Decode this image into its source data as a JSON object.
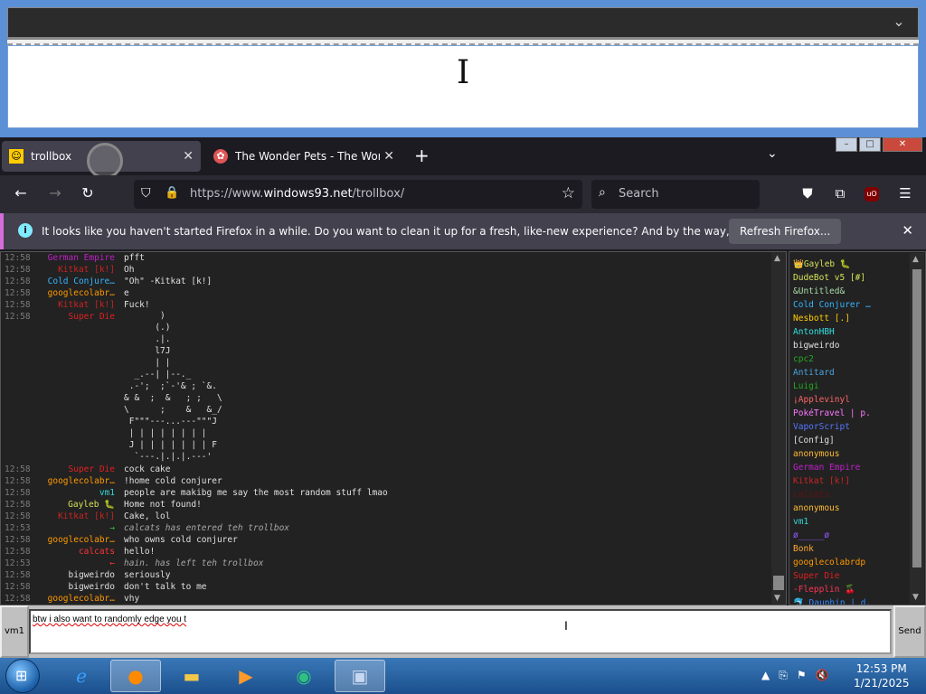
{
  "tabs": [
    {
      "title": "trollbox",
      "favicon": "trollbox-icon"
    },
    {
      "title": "The Wonder Pets - The Wonder",
      "favicon": "wonderpets-icon"
    }
  ],
  "navbar": {
    "url_prefix": "https://www.",
    "url_domain": "windows93.net",
    "url_path": "/trollbox/",
    "search_placeholder": "Search"
  },
  "notification": {
    "message": "It looks like you haven't started Firefox in a while. Do you want to clean it up for a fresh, like-new experience? And by the way, welcome back!",
    "button": "Refresh Firefox..."
  },
  "chat": {
    "lines": [
      {
        "ts": "12:58",
        "nick": "German Empire",
        "color": "#c01fc9",
        "text": "pfft",
        "sys": false
      },
      {
        "ts": "12:58",
        "nick": "Kitkat [k!]",
        "color": "#cc2222",
        "text": "Oh",
        "sys": false
      },
      {
        "ts": "12:58",
        "nick": "Cold Conjure…",
        "color": "#33b5ff",
        "text": "\"Oh\" -Kitkat [k!]",
        "sys": false
      },
      {
        "ts": "12:58",
        "nick": "googlecolabr…",
        "color": "#ff9900",
        "text": "e",
        "sys": false
      },
      {
        "ts": "12:58",
        "nick": "Kitkat [k!]",
        "color": "#cc2222",
        "text": "Fuck!",
        "sys": false
      },
      {
        "ts": "12:58",
        "nick": "Super Die",
        "color": "#e02020",
        "text": "",
        "sys": false
      }
    ],
    "ascii_art": "       )\n      (.)\n      .|.\n      l7J\n      | |\n  _.--| |--._\n .-';  ;`-'& ; `&.\n& &  ;  &   ; ;   \\\n\\      ;    &   &_/\n F\"\"\"---...---\"\"\"J\n | | | | | | | |\n J | | | | | | | F\n  `---.|.|.|.---'",
    "lines2": [
      {
        "ts": "12:58",
        "nick": "Super Die",
        "color": "#e02020",
        "text": "cock cake",
        "sys": false
      },
      {
        "ts": "12:58",
        "nick": "googlecolabr…",
        "color": "#ff9900",
        "text": "!home cold conjurer",
        "sys": false
      },
      {
        "ts": "12:58",
        "nick": "vm1",
        "color": "#33d6d6",
        "text": "people are makibg me say the most random stuff lmao",
        "sys": false
      },
      {
        "ts": "12:58",
        "nick": "Gayleb 🐛",
        "color": "#d4e157",
        "text": "Home not found!",
        "sys": false
      },
      {
        "ts": "12:58",
        "nick": "Kitkat [k!]",
        "color": "#cc2222",
        "text": "Cake, lol",
        "sys": false
      },
      {
        "ts": "12:53",
        "nick": "→",
        "color": "#33cc33",
        "text": "calcats has entered teh trollbox",
        "sys": true
      },
      {
        "ts": "12:58",
        "nick": "googlecolabr…",
        "color": "#ff9900",
        "text": "who owns cold conjurer",
        "sys": false
      },
      {
        "ts": "12:58",
        "nick": "calcats",
        "color": "#ff3333",
        "text": "hello!",
        "sys": false
      },
      {
        "ts": "12:53",
        "nick": "←",
        "color": "#ff3333",
        "text": "hain. has left teh trollbox",
        "sys": true
      },
      {
        "ts": "12:58",
        "nick": "bigweirdo",
        "color": "#e0e0e0",
        "text": "seriously",
        "sys": false
      },
      {
        "ts": "12:58",
        "nick": "bigweirdo",
        "color": "#e0e0e0",
        "text": "don't talk to me",
        "sys": false
      },
      {
        "ts": "12:58",
        "nick": "googlecolabr…",
        "color": "#ff9900",
        "text": "vhy",
        "sys": false
      }
    ]
  },
  "users": [
    {
      "name": "👑Gayleb 🐛",
      "color": "#d4e157"
    },
    {
      "name": "DudeBot v5 [#]",
      "color": "#d4e157"
    },
    {
      "name": "&Untitled&",
      "color": "#aaddaa"
    },
    {
      "name": "Cold Conjurer …",
      "color": "#33b5ff"
    },
    {
      "name": "Nesbott [.]",
      "color": "#ffcc00"
    },
    {
      "name": "AntonHBH",
      "color": "#33e0e0"
    },
    {
      "name": "bigweirdo",
      "color": "#e0e0e0"
    },
    {
      "name": "cpc2",
      "color": "#22aa22"
    },
    {
      "name": "Antitard",
      "color": "#4aa3df"
    },
    {
      "name": "Luigi",
      "color": "#22aa22"
    },
    {
      "name": "¡Applevinyl",
      "color": "#ff6666"
    },
    {
      "name": "PokéTravel | p.",
      "color": "#ff77ff"
    },
    {
      "name": "VaporScript",
      "color": "#5577ff"
    },
    {
      "name": "[Config]",
      "color": "#e0e0e0"
    },
    {
      "name": "anonymous",
      "color": "#ffbb33"
    },
    {
      "name": "German Empire",
      "color": "#c01fc9"
    },
    {
      "name": "Kitkat [k!]",
      "color": "#cc2222"
    },
    {
      "name": "calcats",
      "color": "#661111"
    },
    {
      "name": "anonymous",
      "color": "#ffbb33"
    },
    {
      "name": "vm1",
      "color": "#33d6d6"
    },
    {
      "name": "ø_____ø",
      "color": "#9955ff"
    },
    {
      "name": "Bonk",
      "color": "#ffaa33"
    },
    {
      "name": "googlecolabrdp",
      "color": "#ff9900"
    },
    {
      "name": "Super Die",
      "color": "#e02020"
    },
    {
      "name": "-Flepplin 🍒",
      "color": "#ff3355"
    },
    {
      "name": "🐬 Dauphin | d.",
      "color": "#3388ff"
    }
  ],
  "input": {
    "nick": "vm1",
    "text": "btw i also want to randomly edge you t",
    "send": "Send"
  },
  "taskbar": {
    "time": "12:53 PM",
    "date": "1/21/2025"
  }
}
